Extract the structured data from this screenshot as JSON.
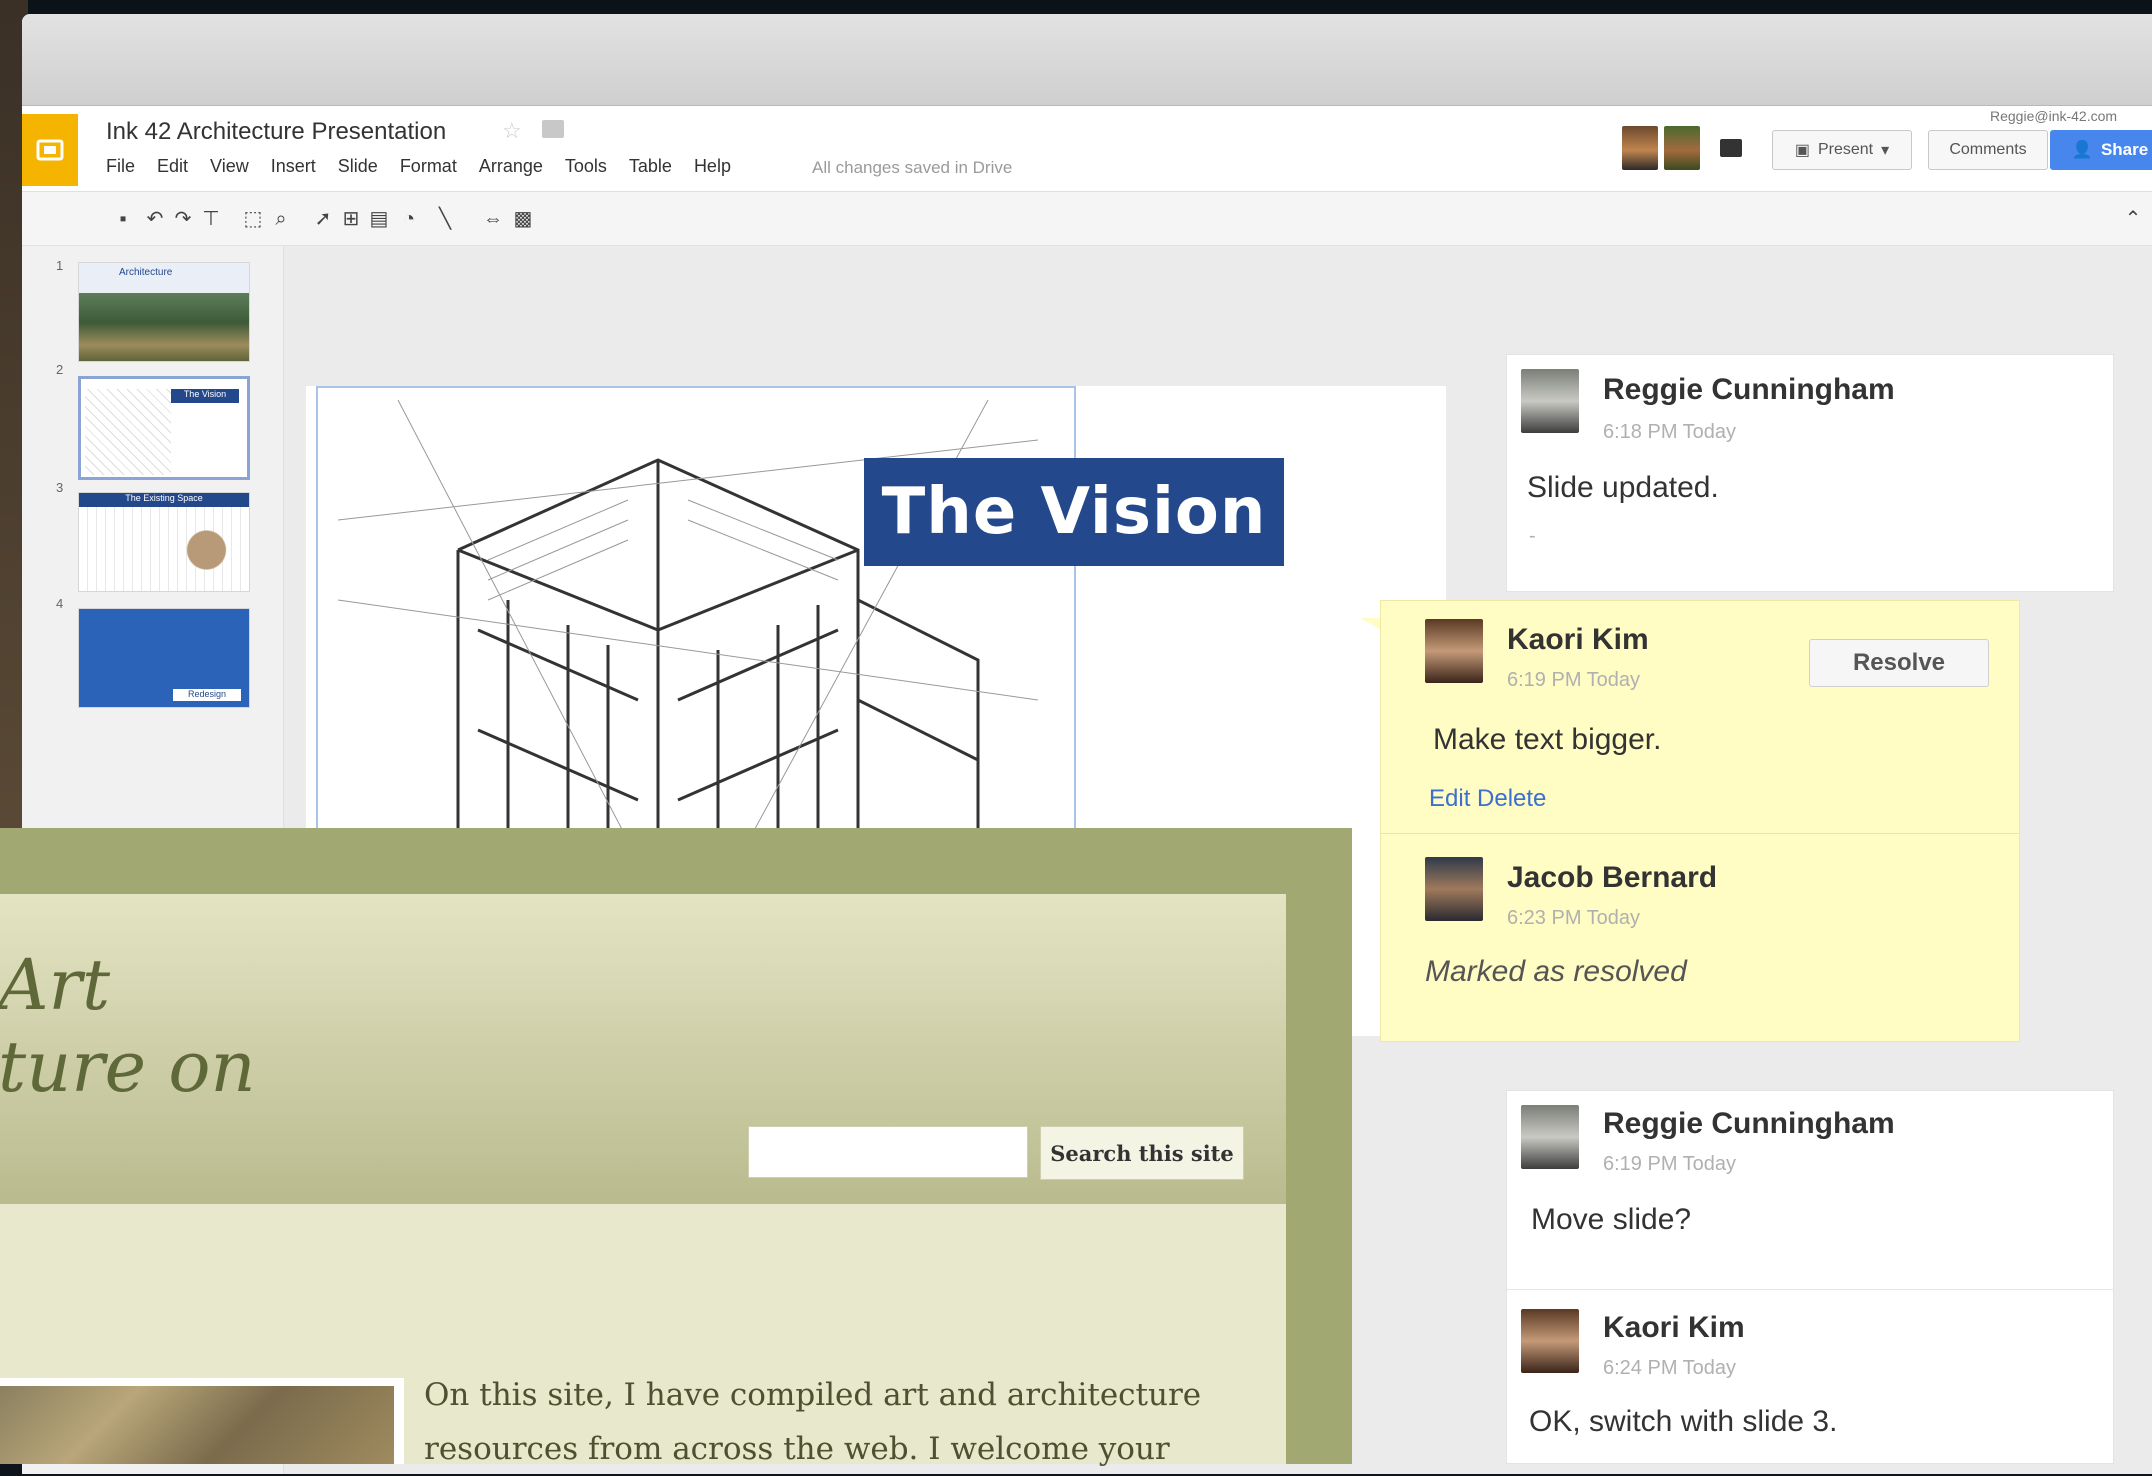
{
  "slides_app": {
    "doc_title": "Ink 42 Architecture Presentation",
    "account_email": "Reggie@ink-42.com",
    "menu": [
      "File",
      "Edit",
      "View",
      "Insert",
      "Slide",
      "Format",
      "Arrange",
      "Tools",
      "Table",
      "Help"
    ],
    "save_status": "All changes saved in Drive",
    "present_label": "Present",
    "comments_label": "Comments",
    "share_label": "Share",
    "thumbnails": [
      {
        "num": "1",
        "label": "Architecture"
      },
      {
        "num": "2",
        "label": "The Vision"
      },
      {
        "num": "3",
        "label": "The Existing Space"
      },
      {
        "num": "4",
        "label": "Redesign"
      }
    ],
    "slide_title": "The Vision",
    "comments": [
      {
        "author": "Reggie Cunningham",
        "time": "6:18 PM Today",
        "text": "Slide updated.",
        "extra": "-"
      },
      {
        "author": "Kaori Kim",
        "time": "6:19 PM Today",
        "text": "Make text bigger.",
        "actions": "Edit Delete",
        "resolve_label": "Resolve"
      },
      {
        "author": "Jacob Bernard",
        "time": "6:23 PM Today",
        "text": "Marked as resolved"
      },
      {
        "author": "Reggie Cunningham",
        "time": "6:19 PM Today",
        "text": "Move slide?"
      },
      {
        "author": "Kaori Kim",
        "time": "6:24 PM Today",
        "text": "OK, switch with slide 3."
      }
    ],
    "colors": {
      "accent": "#24488c",
      "logo": "#f4b400",
      "share": "#4787ed",
      "active_comment": "#fffcc4"
    }
  },
  "website": {
    "title_line1": "Art",
    "title_line2": "ture on",
    "search_button": "Search this site",
    "search_placeholder": "",
    "intro_line1": "On this site, I have compiled art and architecture",
    "intro_line2": "resources from across the web. I welcome your",
    "colors": {
      "frame": "#a2a872",
      "header": "#b9bb8e",
      "body": "#e8e8cc"
    }
  }
}
